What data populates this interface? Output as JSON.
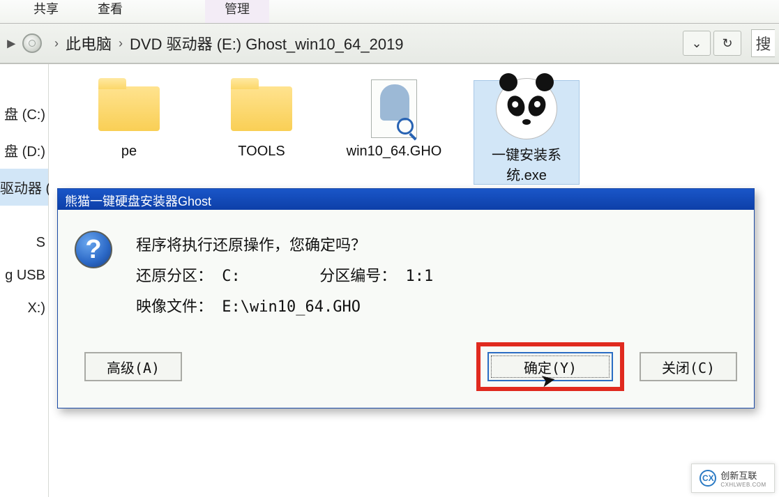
{
  "ribbon": {
    "tabs": [
      "共享",
      "查看"
    ],
    "manage_tab": "管理"
  },
  "breadcrumb": {
    "items": [
      "此电脑",
      "DVD 驱动器 (E:) Ghost_win10_64_2019"
    ]
  },
  "search": {
    "placeholder": "搜"
  },
  "sidebar": {
    "items": [
      {
        "label": "盘 (C:)"
      },
      {
        "label": "盘 (D:)"
      },
      {
        "label": "驱动器 (E:) C"
      },
      {
        "label": "S"
      },
      {
        "label": "g USB"
      },
      {
        "label": "X:)"
      }
    ],
    "selected_index": 2
  },
  "files": [
    {
      "name": "pe",
      "type": "folder"
    },
    {
      "name": "TOOLS",
      "type": "folder"
    },
    {
      "name": "win10_64.GHO",
      "type": "gho"
    },
    {
      "name": "一键安装系统.exe",
      "type": "panda",
      "selected": true
    }
  ],
  "dialog": {
    "title": "熊猫一键硬盘安装器Ghost",
    "message": "程序将执行还原操作，您确定吗？",
    "restore_label": "还原分区：",
    "restore_value": "C:",
    "partnum_label": "分区编号：",
    "partnum_value": "1:1",
    "image_label": "映像文件：",
    "image_value": "E:\\win10_64.GHO",
    "advanced_btn": "高级(A)",
    "ok_btn": "确定(Y)",
    "close_btn": "关闭(C)"
  },
  "watermark": {
    "brand": "创新互联",
    "sub": "CXHLWEB.COM"
  }
}
